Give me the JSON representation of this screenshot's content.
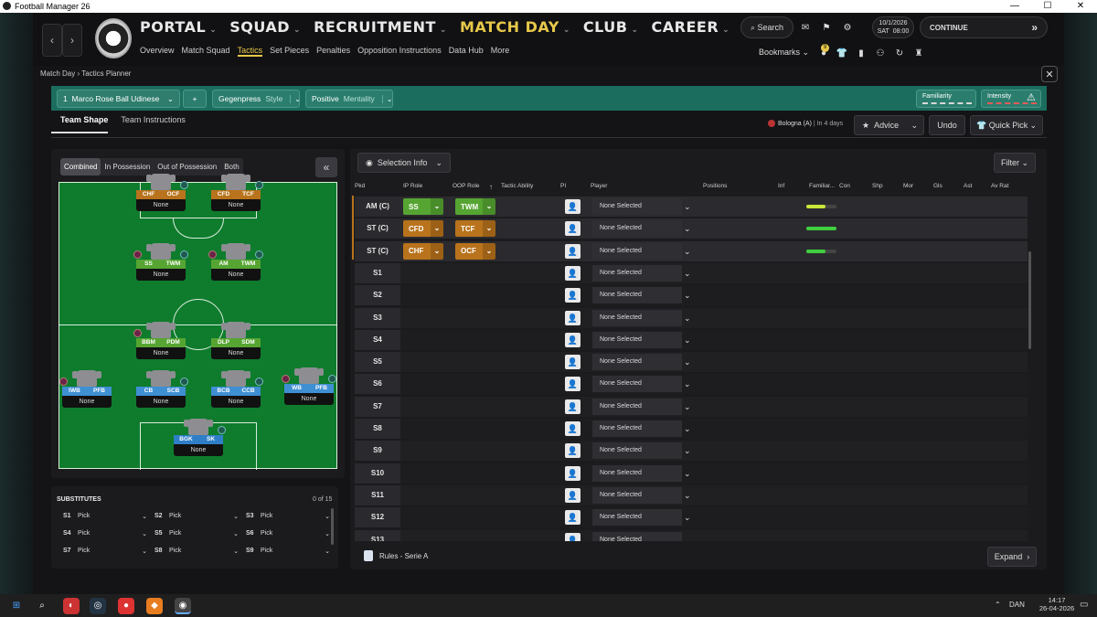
{
  "window": {
    "title": "Football Manager 26",
    "minimize": "—",
    "maximize": "☐",
    "close": "✕"
  },
  "nav": {
    "main": [
      {
        "label": "PORTAL",
        "active": false
      },
      {
        "label": "SQUAD",
        "active": false
      },
      {
        "label": "RECRUITMENT",
        "active": false
      },
      {
        "label": "MATCH DAY",
        "active": true
      },
      {
        "label": "CLUB",
        "active": false
      },
      {
        "label": "CAREER",
        "active": false
      }
    ],
    "sub": [
      {
        "label": "Overview",
        "active": false
      },
      {
        "label": "Match Squad",
        "active": false
      },
      {
        "label": "Tactics",
        "active": true
      },
      {
        "label": "Set Pieces",
        "active": false
      },
      {
        "label": "Penalties",
        "active": false
      },
      {
        "label": "Opposition Instructions",
        "active": false
      },
      {
        "label": "Data Hub",
        "active": false
      },
      {
        "label": "More",
        "active": false
      }
    ],
    "search": "Search",
    "date": "10/1/2026",
    "day": "SAT",
    "time": "08:00",
    "continue": "CONTINUE",
    "bookmarks": "Bookmarks",
    "notif_count": "9"
  },
  "breadcrumb": {
    "a": "Match Day",
    "b": "Tactics Planner"
  },
  "tactic": {
    "slot": "1",
    "name": "Marco Rose Ball Udinese",
    "add": "+",
    "style_value": "Gegenpress",
    "style_label": "Style",
    "mentality_value": "Positive",
    "mentality_label": "Mentality",
    "familiarity": "Familiarity",
    "intensity": "Intensity"
  },
  "tabs": {
    "shape": "Team Shape",
    "instructions": "Team Instructions"
  },
  "match": {
    "opponent": "Bologna (A)",
    "when": "In 4 days"
  },
  "actions": {
    "advice": "Advice",
    "undo": "Undo",
    "quick_pick": "Quick Pick"
  },
  "phase": {
    "combined": "Combined",
    "in_possession": "In Possession",
    "out_possession": "Out of Possession",
    "both": "Both",
    "collapse": "«"
  },
  "pitch_players": [
    {
      "ip": "CHF",
      "oop": "OCF",
      "ipc": "#b8731c",
      "oopc": "#b8731c",
      "name": "None"
    },
    {
      "ip": "CFD",
      "oop": "TCF",
      "ipc": "#b8731c",
      "oopc": "#b8731c",
      "name": "None"
    },
    {
      "ip": "SS",
      "oop": "TWM",
      "ipc": "#56a532",
      "oopc": "#56a532",
      "name": "None"
    },
    {
      "ip": "AM",
      "oop": "TWM",
      "ipc": "#56a532",
      "oopc": "#56a532",
      "name": "None"
    },
    {
      "ip": "BBM",
      "oop": "PDM",
      "ipc": "#56a532",
      "oopc": "#56a532",
      "name": "None"
    },
    {
      "ip": "DLP",
      "oop": "SDM",
      "ipc": "#56a532",
      "oopc": "#56a532",
      "name": "None"
    },
    {
      "ip": "IWB",
      "oop": "PFB",
      "ipc": "#3f8fd3",
      "oopc": "#3f8fd3",
      "name": "None"
    },
    {
      "ip": "CB",
      "oop": "SCB",
      "ipc": "#3f8fd3",
      "oopc": "#3f8fd3",
      "name": "None"
    },
    {
      "ip": "BCB",
      "oop": "CCB",
      "ipc": "#3f8fd3",
      "oopc": "#3f8fd3",
      "name": "None"
    },
    {
      "ip": "WB",
      "oop": "PFB",
      "ipc": "#3f8fd3",
      "oopc": "#3f8fd3",
      "name": "None"
    },
    {
      "ip": "BGK",
      "oop": "SK",
      "ipc": "#2f7fc8",
      "oopc": "#2f7fc8",
      "name": "None"
    }
  ],
  "subs": {
    "title": "SUBSTITUTES",
    "count": "0 of 15",
    "slots": [
      {
        "pos": "S1",
        "label": "Pick"
      },
      {
        "pos": "S2",
        "label": "Pick"
      },
      {
        "pos": "S3",
        "label": "Pick"
      },
      {
        "pos": "S4",
        "label": "Pick"
      },
      {
        "pos": "S5",
        "label": "Pick"
      },
      {
        "pos": "S6",
        "label": "Pick"
      },
      {
        "pos": "S7",
        "label": "Pick"
      },
      {
        "pos": "S8",
        "label": "Pick"
      },
      {
        "pos": "S9",
        "label": "Pick"
      }
    ]
  },
  "selection": {
    "info": "Selection Info",
    "filter": "Filter"
  },
  "table": {
    "headers": [
      "Pkd",
      "IP Role",
      "OOP Role",
      "Tactic Ability",
      "PI",
      "Player",
      "Positions",
      "Inf",
      "Familiar...",
      "Con",
      "Shp",
      "Mor",
      "Gls",
      "Ast",
      "Av Rat"
    ],
    "rows": [
      {
        "pos": "AM (C)",
        "ip": "SS",
        "oop": "TWM",
        "ipc": "#56a532",
        "oopc": "#56a532",
        "player": "None Selected",
        "fam": 0.65,
        "famc": "#c8e63a"
      },
      {
        "pos": "ST (C)",
        "ip": "CFD",
        "oop": "TCF",
        "ipc": "#b8731c",
        "oopc": "#b8731c",
        "player": "None Selected",
        "fam": 1.0,
        "famc": "#3fcf3f"
      },
      {
        "pos": "ST (C)",
        "ip": "CHF",
        "oop": "OCF",
        "ipc": "#b8731c",
        "oopc": "#b8731c",
        "player": "None Selected",
        "fam": 0.65,
        "famc": "#3fcf3f"
      },
      {
        "pos": "S1",
        "player": "None Selected"
      },
      {
        "pos": "S2",
        "player": "None Selected"
      },
      {
        "pos": "S3",
        "player": "None Selected"
      },
      {
        "pos": "S4",
        "player": "None Selected"
      },
      {
        "pos": "S5",
        "player": "None Selected"
      },
      {
        "pos": "S6",
        "player": "None Selected"
      },
      {
        "pos": "S7",
        "player": "None Selected"
      },
      {
        "pos": "S8",
        "player": "None Selected"
      },
      {
        "pos": "S9",
        "player": "None Selected"
      },
      {
        "pos": "S10",
        "player": "None Selected"
      },
      {
        "pos": "S11",
        "player": "None Selected"
      },
      {
        "pos": "S12",
        "player": "None Selected"
      },
      {
        "pos": "S13",
        "player": "None Selected"
      }
    ]
  },
  "footer": {
    "rules": "Rules - Serie A",
    "expand": "Expand"
  },
  "taskbar": {
    "lang": "DAN",
    "time": "14:17",
    "date": "26-04-2026"
  }
}
